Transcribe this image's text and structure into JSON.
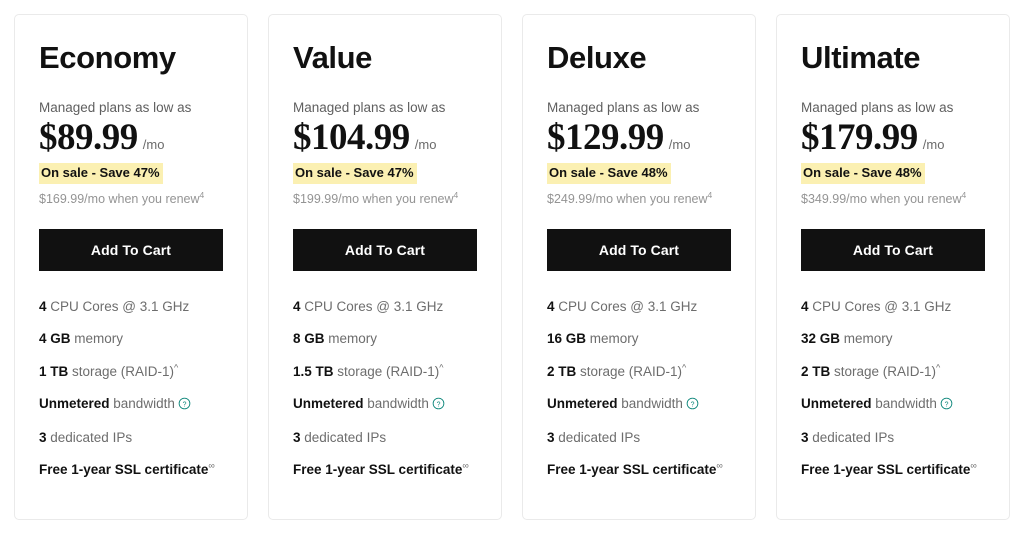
{
  "plans": [
    {
      "title": "Economy",
      "tagline": "Managed plans as low as",
      "price": "$89.99",
      "period": "/mo",
      "sale_badge": "On sale - Save 47%",
      "renew_note": "$169.99/mo when you renew",
      "renew_marker": "4",
      "cta_label": "Add To Cart",
      "features": [
        {
          "strong": "4",
          "rest": " CPU Cores @ 3.1 GHz",
          "marker": "",
          "info_icon": false
        },
        {
          "strong": "4 GB",
          "rest": " memory",
          "marker": "",
          "info_icon": false
        },
        {
          "strong": "1 TB",
          "rest": " storage (RAID-1)",
          "marker": "^",
          "info_icon": false
        },
        {
          "strong": "Unmetered",
          "rest": " bandwidth",
          "marker": "",
          "info_icon": true
        },
        {
          "strong": "3",
          "rest": " dedicated IPs",
          "marker": "",
          "info_icon": false
        },
        {
          "strong": "Free 1-year SSL certificate",
          "rest": "",
          "marker": "∞",
          "info_icon": false
        }
      ]
    },
    {
      "title": "Value",
      "tagline": "Managed plans as low as",
      "price": "$104.99",
      "period": "/mo",
      "sale_badge": "On sale - Save 47%",
      "renew_note": "$199.99/mo when you renew",
      "renew_marker": "4",
      "cta_label": "Add To Cart",
      "features": [
        {
          "strong": "4",
          "rest": " CPU Cores @ 3.1 GHz",
          "marker": "",
          "info_icon": false
        },
        {
          "strong": "8 GB",
          "rest": " memory",
          "marker": "",
          "info_icon": false
        },
        {
          "strong": "1.5 TB",
          "rest": " storage (RAID-1)",
          "marker": "^",
          "info_icon": false
        },
        {
          "strong": "Unmetered",
          "rest": " bandwidth",
          "marker": "",
          "info_icon": true
        },
        {
          "strong": "3",
          "rest": " dedicated IPs",
          "marker": "",
          "info_icon": false
        },
        {
          "strong": "Free 1-year SSL certificate",
          "rest": "",
          "marker": "∞",
          "info_icon": false
        }
      ]
    },
    {
      "title": "Deluxe",
      "tagline": "Managed plans as low as",
      "price": "$129.99",
      "period": "/mo",
      "sale_badge": "On sale - Save 48%",
      "renew_note": "$249.99/mo when you renew",
      "renew_marker": "4",
      "cta_label": "Add To Cart",
      "features": [
        {
          "strong": "4",
          "rest": " CPU Cores @ 3.1 GHz",
          "marker": "",
          "info_icon": false
        },
        {
          "strong": "16 GB",
          "rest": " memory",
          "marker": "",
          "info_icon": false
        },
        {
          "strong": "2 TB",
          "rest": " storage (RAID-1)",
          "marker": "^",
          "info_icon": false
        },
        {
          "strong": "Unmetered",
          "rest": " bandwidth",
          "marker": "",
          "info_icon": true
        },
        {
          "strong": "3",
          "rest": " dedicated IPs",
          "marker": "",
          "info_icon": false
        },
        {
          "strong": "Free 1-year SSL certificate",
          "rest": "",
          "marker": "∞",
          "info_icon": false
        }
      ]
    },
    {
      "title": "Ultimate",
      "tagline": "Managed plans as low as",
      "price": "$179.99",
      "period": "/mo",
      "sale_badge": "On sale - Save 48%",
      "renew_note": "$349.99/mo when you renew",
      "renew_marker": "4",
      "cta_label": "Add To Cart",
      "features": [
        {
          "strong": "4",
          "rest": " CPU Cores @ 3.1 GHz",
          "marker": "",
          "info_icon": false
        },
        {
          "strong": "32 GB",
          "rest": " memory",
          "marker": "",
          "info_icon": false
        },
        {
          "strong": "2 TB",
          "rest": " storage (RAID-1)",
          "marker": "^",
          "info_icon": false
        },
        {
          "strong": "Unmetered",
          "rest": " bandwidth",
          "marker": "",
          "info_icon": true
        },
        {
          "strong": "3",
          "rest": " dedicated IPs",
          "marker": "",
          "info_icon": false
        },
        {
          "strong": "Free 1-year SSL certificate",
          "rest": "",
          "marker": "∞",
          "info_icon": false
        }
      ]
    }
  ],
  "colors": {
    "cta_background": "#111111",
    "sale_highlight": "#fbf0b2",
    "info_icon": "#0c867a",
    "card_border": "#eaeaea"
  }
}
